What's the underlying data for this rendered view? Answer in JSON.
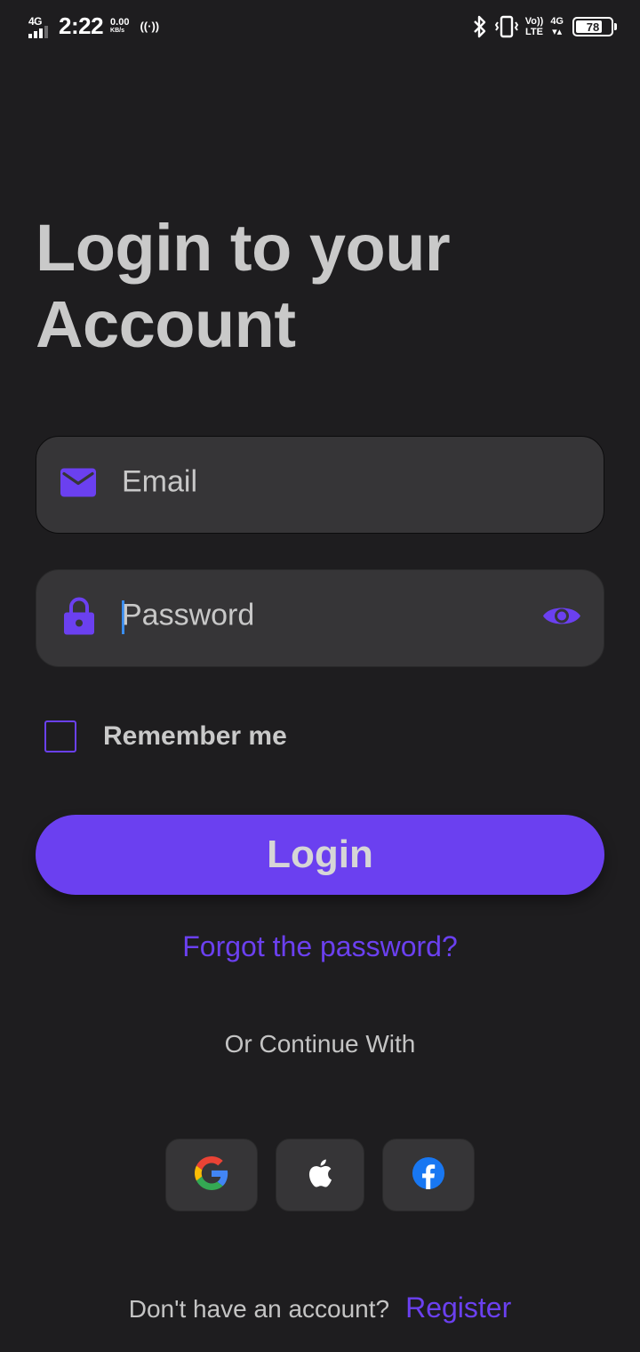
{
  "status_bar": {
    "network": "4G",
    "time": "2:22",
    "speed_value": "0.00",
    "speed_unit": "KB/s",
    "volte_top": "Vo))",
    "volte_bottom": "LTE",
    "net_type": "4G",
    "battery": "78",
    "battery_level": 78
  },
  "title": {
    "line1": "Login to your",
    "line2": "Account"
  },
  "email": {
    "placeholder": "Email",
    "icon": "mail-icon"
  },
  "password": {
    "placeholder": "Password",
    "icon": "lock-icon",
    "toggle_icon": "eye-icon"
  },
  "remember": {
    "label": "Remember me",
    "checked": false
  },
  "login_button": {
    "label": "Login"
  },
  "forgot_link": "Forgot the password?",
  "divider_text": "Or Continue With",
  "social": [
    {
      "name": "google",
      "icon": "google-icon"
    },
    {
      "name": "apple",
      "icon": "apple-icon"
    },
    {
      "name": "facebook",
      "icon": "facebook-icon"
    }
  ],
  "footer": {
    "question": "Don't have an account?",
    "register": "Register"
  },
  "colors": {
    "background": "#1e1d1f",
    "accent": "#6b40f0",
    "field_bg": "#363537",
    "text": "#c9c9c9"
  }
}
